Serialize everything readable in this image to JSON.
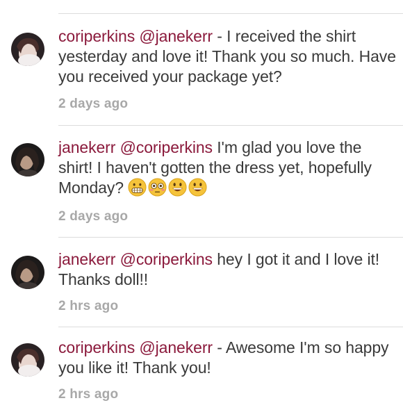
{
  "comments": [
    {
      "username": "coriperkins",
      "mention": "@janekerr",
      "body": " - I received the shirt yesterday and love it! Thank you so much. Have you received your package yet?",
      "time": "2 days ago",
      "avatar": "coriperkins-avatar"
    },
    {
      "username": "janekerr",
      "mention": "@coriperkins",
      "body": " I'm glad you love the shirt! I haven't gotten the dress yet, hopefully Monday? ",
      "time": "2 days ago",
      "avatar": "janekerr-avatar",
      "emojis": [
        "grimacing-face-emoji",
        "flushed-face-emoji",
        "grinning-face-emoji",
        "grinning-face-emoji"
      ]
    },
    {
      "username": "janekerr",
      "mention": "@coriperkins",
      "body": " hey I got it and I love it! Thanks doll!!",
      "time": "2 hrs ago",
      "avatar": "janekerr-avatar"
    },
    {
      "username": "coriperkins",
      "mention": "@janekerr",
      "body": " - Awesome I'm so happy you like it! Thank you!",
      "time": "2 hrs ago",
      "avatar": "coriperkins-avatar"
    }
  ],
  "colors": {
    "username": "#8b1a3c",
    "body_text": "#3a3a3a",
    "timestamp": "#a8a8a8",
    "divider": "#dcdcdc"
  }
}
